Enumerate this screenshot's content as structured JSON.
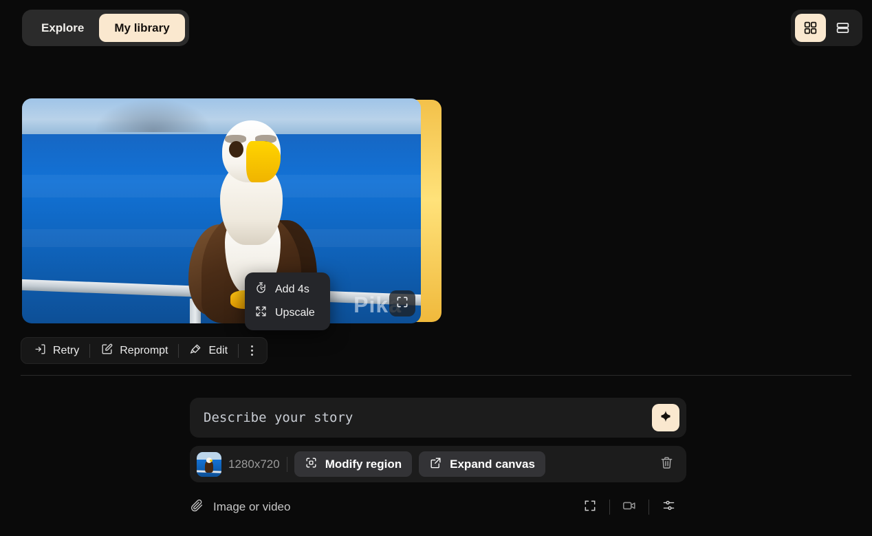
{
  "nav": {
    "tabs": [
      {
        "label": "Explore",
        "active": false,
        "name": "tab-explore"
      },
      {
        "label": "My library",
        "active": true,
        "name": "tab-my-library"
      }
    ]
  },
  "view_toggle": {
    "grid_label": "grid-view",
    "list_label": "list-view",
    "active": "grid",
    "active_bg": "#fae8cf"
  },
  "media_card": {
    "watermark": "Pika",
    "resize_icon": "aspect-ratio-icon"
  },
  "context_menu": {
    "items": [
      {
        "label": "Add 4s",
        "icon": "timer-icon"
      },
      {
        "label": "Upscale",
        "icon": "expand-arrows-icon"
      }
    ]
  },
  "action_bar": {
    "retry": "Retry",
    "reprompt": "Reprompt",
    "edit": "Edit",
    "more": "more-options"
  },
  "composer": {
    "placeholder": "Describe your story",
    "value": "",
    "generate_icon": "sparkle-icon",
    "resolution": "1280x720",
    "modify_region": "Modify region",
    "expand_canvas": "Expand canvas",
    "delete_icon": "trash-icon",
    "attach_label": "Image or video",
    "tools": [
      {
        "name": "aspect-ratio-icon"
      },
      {
        "name": "video-camera-icon"
      },
      {
        "name": "settings-sliders-icon"
      }
    ]
  },
  "colors": {
    "background": "#0a0a0a",
    "accent_cream": "#fae8cf",
    "panel": "#1c1c1c",
    "pill": "#333336"
  }
}
